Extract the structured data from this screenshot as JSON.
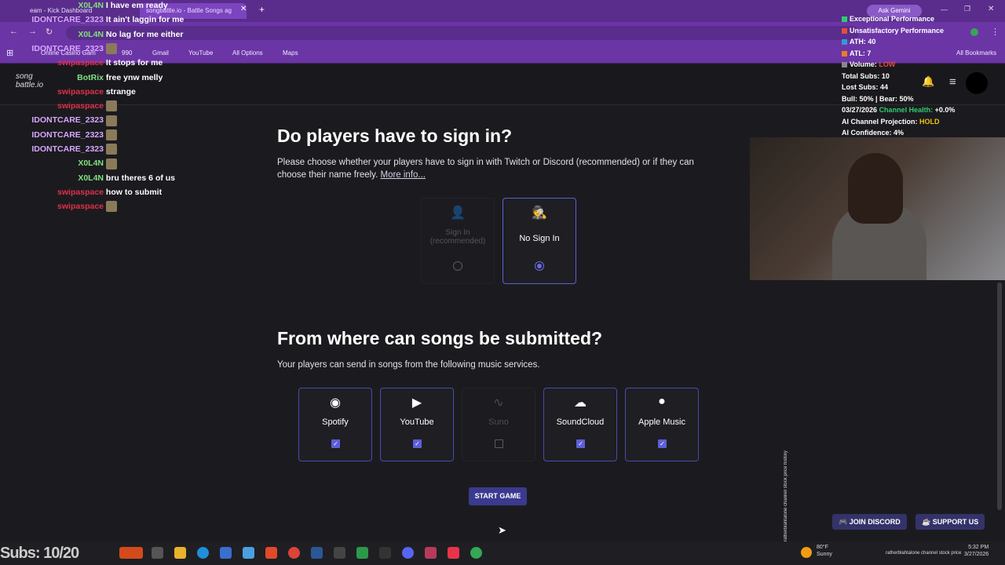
{
  "browser": {
    "tabs": [
      {
        "label": "eam - Kick Dashboard"
      },
      {
        "label": "songbattle.io - Battle Songs ag"
      }
    ],
    "new_tab": "+",
    "ask_gemini": "Ask Gemini",
    "bookmarks": [
      {
        "label": "Online Casino Gam"
      },
      {
        "label": "990"
      },
      {
        "label": "Gmail"
      },
      {
        "label": "YouTube"
      },
      {
        "label": "All Options"
      },
      {
        "label": "Maps"
      }
    ],
    "all_bookmarks": "All Bookmarks"
  },
  "site": {
    "logo_line1": "song",
    "logo_line2": "battle.io"
  },
  "signin": {
    "title": "Do players have to sign in?",
    "description": "Please choose whether your players have to sign in with Twitch or Discord (recommended) or if they can choose their name freely.",
    "more_info": "More info...",
    "options": [
      {
        "label": "Sign In (recommended)",
        "icon": "user-icon",
        "selected": false,
        "disabled": true
      },
      {
        "label": "No Sign In",
        "icon": "incognito-icon",
        "selected": true,
        "disabled": false
      }
    ]
  },
  "sources": {
    "title": "From where can songs be submitted?",
    "description": "Your players can send in songs from the following music services.",
    "services": [
      {
        "label": "Spotify",
        "icon": "spotify-icon",
        "checked": true,
        "disabled": false
      },
      {
        "label": "YouTube",
        "icon": "youtube-icon",
        "checked": true,
        "disabled": false
      },
      {
        "label": "Suno",
        "icon": "suno-icon",
        "checked": false,
        "disabled": true
      },
      {
        "label": "SoundCloud",
        "icon": "soundcloud-icon",
        "checked": true,
        "disabled": false
      },
      {
        "label": "Apple Music",
        "icon": "apple-icon",
        "checked": true,
        "disabled": false
      }
    ],
    "start_button": "START GAME"
  },
  "footer": {
    "discord": "JOIN DISCORD",
    "support": "SUPPORT US"
  },
  "chat": [
    {
      "user": "X0L4N",
      "color": "#7fe07f",
      "msg": "I have em ready"
    },
    {
      "user": "IDONTCARE_2323",
      "color": "#d8a6ff",
      "msg": "It ain't laggin for me"
    },
    {
      "user": "X0L4N",
      "color": "#7fe07f",
      "msg": "No lag for me either"
    },
    {
      "user": "IDONTCARE_2323",
      "color": "#d8a6ff",
      "msg": ""
    },
    {
      "user": "swipaspace",
      "color": "#e0304a",
      "msg": "It stops for me"
    },
    {
      "user": "BotRix",
      "color": "#7fe07f",
      "msg": "free ynw melly"
    },
    {
      "user": "swipaspace",
      "color": "#e0304a",
      "msg": "strange"
    },
    {
      "user": "swipaspace",
      "color": "#e0304a",
      "msg": ""
    },
    {
      "user": "IDONTCARE_2323",
      "color": "#d8a6ff",
      "msg": ""
    },
    {
      "user": "IDONTCARE_2323",
      "color": "#d8a6ff",
      "msg": ""
    },
    {
      "user": "IDONTCARE_2323",
      "color": "#d8a6ff",
      "msg": ""
    },
    {
      "user": "X0L4N",
      "color": "#7fe07f",
      "msg": ""
    },
    {
      "user": "X0L4N",
      "color": "#7fe07f",
      "msg": "bru theres 6 of us"
    },
    {
      "user": "swipaspace",
      "color": "#e0304a",
      "msg": "how to submit"
    },
    {
      "user": "swipaspace",
      "color": "#e0304a",
      "msg": ""
    }
  ],
  "stats": {
    "exceptional": "Exceptional Performance",
    "unsatisfactory": "Unsatisfactory Performance",
    "ath": "ATH: 40",
    "atl": "ATL: 7",
    "volume_label": "Volume:",
    "volume_value": "LOW",
    "total_subs": "Total Subs: 10",
    "lost_subs": "Lost Subs: 44",
    "bull_bear": "Bull: 50% | Bear: 50%",
    "date": "03/27/2026",
    "channel_health_label": "Channel Health:",
    "channel_health_value": "+0.0%",
    "projection_label": "AI Channel Projection:",
    "projection_value": "HOLD",
    "confidence": "AI Confidence: 4%",
    "colors": {
      "green": "#2ecc71",
      "red": "#e74c3c",
      "blue": "#3498db",
      "orange": "#e67e22",
      "low": "#e74c3c",
      "hold": "#f1c40f"
    }
  },
  "side_text": "ratherblahtalone channel stock price history",
  "taskbar": {
    "subs": "Subs: 10/20",
    "weather_temp": "80°F",
    "weather_cond": "Sunny",
    "time": "5:32 PM",
    "date": "3/27/2026",
    "tray_text": "ratherblahtalone channel stock price"
  }
}
